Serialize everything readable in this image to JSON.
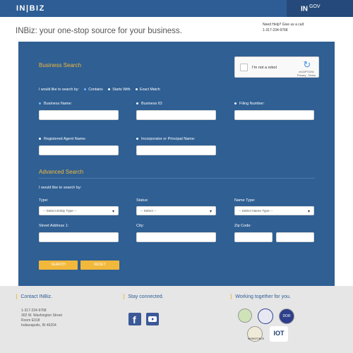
{
  "header": {
    "logo_text": "IN|BIZ",
    "ingov_text": "IN",
    "ingov_sub": "GOV"
  },
  "tagline": "INBiz: your one-stop source for your business.",
  "help": {
    "line1": "Need Help? Give us a call:",
    "phone": "1-317-234-9768"
  },
  "business_search": {
    "title": "Business Search",
    "search_by_label": "I would like to search by:",
    "options": [
      "Contains",
      "Starts With",
      "Exact Match"
    ],
    "selected_option": "Contains",
    "fields": {
      "business_name": "Business Name:",
      "business_id": "Business ID:",
      "filing_number": "Filing Number:",
      "registered_agent": "Registered Agent Name:",
      "incorporator": "Incorporator or Principal Name:"
    },
    "captcha": {
      "label": "I'm not a robot",
      "brand": "reCAPTCHA",
      "links": "Privacy - Terms"
    }
  },
  "advanced_search": {
    "title": "Advanced Search",
    "search_by_label": "I would like to search by:",
    "type_label": "Type:",
    "type_value": "-- Select Entity Type --",
    "status_label": "Status:",
    "status_value": "-- Select --",
    "name_type_label": "Name Type:",
    "name_type_value": "-- Select Name Type --",
    "street_label": "Street Address 1:",
    "city_label": "City:",
    "zip_label": "Zip Code:"
  },
  "buttons": {
    "search": "SEARCH",
    "reset": "RESET"
  },
  "footer": {
    "contact_title": "Contact INBiz.",
    "phone": "1-317-234-9768",
    "address1": "302 W. Washington Street",
    "address2": "Room E018",
    "address3": "Indianapolis, IN 46204",
    "connected_title": "Stay connected.",
    "together_title": "Working together for you.",
    "badges": [
      "DOR",
      "WORKFORCE",
      "IOT"
    ]
  },
  "colors": {
    "brand": "#2d5d94",
    "accent": "#f2b83b",
    "panel": "#2f5f93"
  }
}
